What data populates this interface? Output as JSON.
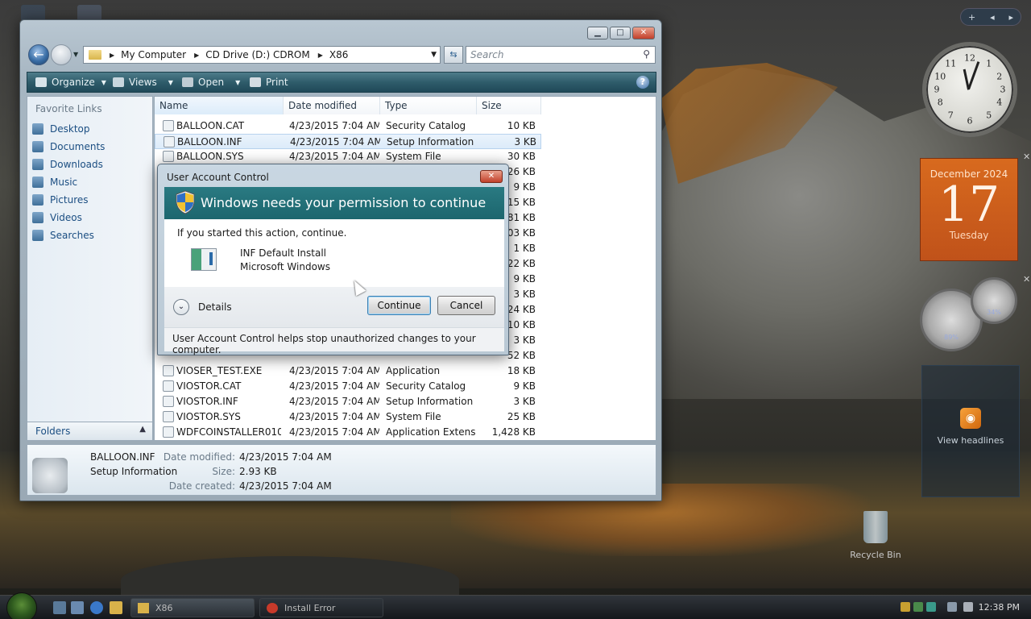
{
  "desktop": {
    "calendar": {
      "month": "December 2024",
      "day": "17",
      "weekday": "Tuesday"
    },
    "meters": {
      "cpu": "89%",
      "memory": "34%"
    },
    "feed_label": "View headlines",
    "recycle_bin": "Recycle Bin"
  },
  "explorer": {
    "address": {
      "crumbs": [
        "My Computer",
        "CD Drive (D:) CDROM",
        "X86"
      ]
    },
    "search_placeholder": "Search",
    "toolbar": {
      "organize": "Organize",
      "views": "Views",
      "open": "Open",
      "print": "Print"
    },
    "nav": {
      "header": "Favorite Links",
      "items": [
        "Desktop",
        "Documents",
        "Downloads",
        "Music",
        "Pictures",
        "Videos",
        "Searches"
      ],
      "folders": "Folders"
    },
    "columns": {
      "name": "Name",
      "date": "Date modified",
      "type": "Type",
      "size": "Size"
    },
    "files": [
      {
        "name": "BALLOON.CAT",
        "date": "4/23/2015 7:04 AM",
        "type": "Security Catalog",
        "size": "10 KB"
      },
      {
        "name": "BALLOON.INF",
        "date": "4/23/2015 7:04 AM",
        "type": "Setup Information",
        "size": "3 KB"
      },
      {
        "name": "BALLOON.SYS",
        "date": "4/23/2015 7:04 AM",
        "type": "System File",
        "size": "30 KB"
      },
      {
        "name": "",
        "date": "",
        "type": "",
        "size": "26 KB"
      },
      {
        "name": "",
        "date": "",
        "type": "",
        "size": "9 KB"
      },
      {
        "name": "",
        "date": "",
        "type": "",
        "size": "15 KB"
      },
      {
        "name": "",
        "date": "",
        "type": "",
        "size": "81 KB"
      },
      {
        "name": "",
        "date": "",
        "type": "",
        "size": "03 KB"
      },
      {
        "name": "",
        "date": "",
        "type": "",
        "size": "1 KB"
      },
      {
        "name": "",
        "date": "",
        "type": "",
        "size": "22 KB"
      },
      {
        "name": "",
        "date": "",
        "type": "",
        "size": "9 KB"
      },
      {
        "name": "",
        "date": "",
        "type": "",
        "size": "3 KB"
      },
      {
        "name": "",
        "date": "",
        "type": "",
        "size": "24 KB"
      },
      {
        "name": "",
        "date": "",
        "type": "",
        "size": "10 KB"
      },
      {
        "name": "",
        "date": "",
        "type": "",
        "size": "3 KB"
      },
      {
        "name": "",
        "date": "",
        "type": "",
        "size": "52 KB"
      },
      {
        "name": "VIOSER_TEST.EXE",
        "date": "4/23/2015 7:04 AM",
        "type": "Application",
        "size": "18 KB"
      },
      {
        "name": "VIOSTOR.CAT",
        "date": "4/23/2015 7:04 AM",
        "type": "Security Catalog",
        "size": "9 KB"
      },
      {
        "name": "VIOSTOR.INF",
        "date": "4/23/2015 7:04 AM",
        "type": "Setup Information",
        "size": "3 KB"
      },
      {
        "name": "VIOSTOR.SYS",
        "date": "4/23/2015 7:04 AM",
        "type": "System File",
        "size": "25 KB"
      },
      {
        "name": "WDFCOINSTALLER010...",
        "date": "4/23/2015 7:04 AM",
        "type": "Application Extens...",
        "size": "1,428 KB"
      }
    ],
    "details": {
      "name": "BALLOON.INF",
      "type": "Setup Information",
      "modified_label": "Date modified:",
      "modified": "4/23/2015 7:04 AM",
      "size_label": "Size:",
      "size": "2.93 KB",
      "created_label": "Date created:",
      "created": "4/23/2015 7:04 AM"
    }
  },
  "uac": {
    "title": "User Account Control",
    "heading": "Windows needs your permission to continue",
    "lead": "If you started this action, continue.",
    "program": "INF Default Install",
    "publisher": "Microsoft Windows",
    "details": "Details",
    "continue": "Continue",
    "cancel": "Cancel",
    "footer": "User Account Control helps stop unauthorized changes to your computer."
  },
  "taskbar": {
    "tasks": [
      "X86",
      "Install Error"
    ],
    "time": "12:38 PM"
  }
}
